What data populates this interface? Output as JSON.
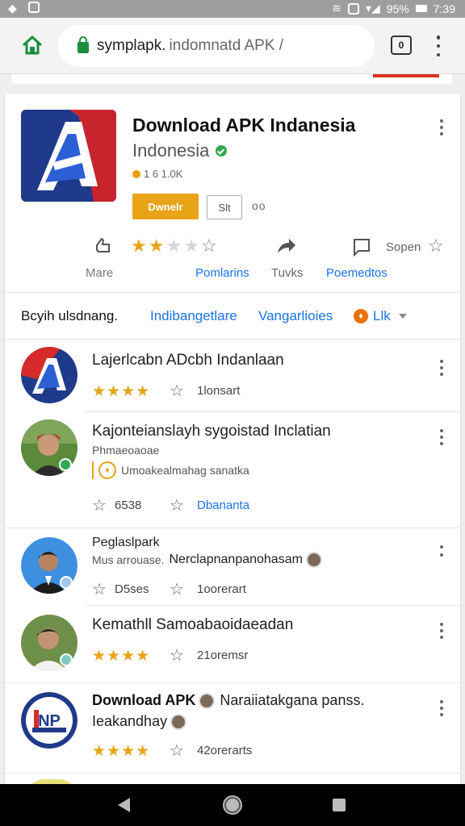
{
  "status_bar": {
    "battery": "95%",
    "time": "7:39"
  },
  "browser": {
    "url_host": "symplapk.",
    "url_path": "indomnatd APK /",
    "tab_count": "0"
  },
  "app": {
    "title": "Download APK Indanesia",
    "developer": "Indonesia",
    "size": "1 6 1.0K",
    "download_label": "Dwnelr",
    "share_label": "Slt",
    "more_label": "oo"
  },
  "actions": {
    "more_label": "Mare",
    "rating_label": "Pomlarins",
    "share_label": "Tuvks",
    "open_label": "Sopen",
    "related_label": "Poemedtos",
    "rating": 2
  },
  "filters": {
    "title": "Bcyih ulsdnang.",
    "link1": "Indibangetlare",
    "link2": "Vangarlioies",
    "chip": "Llk"
  },
  "items": [
    {
      "title": "Lajerlcabn ADcbh Indanlaan",
      "stars": "★★★★",
      "meta": "1lonsart",
      "rating": 4
    },
    {
      "title": "Kajonteianslayh sygoistad Inclatian",
      "sub1": "Phmaeoaoae",
      "sub2": "Umoakealmahag sanatka",
      "meta1": "6538",
      "meta2": "Dbananta"
    },
    {
      "title": "Peglaslpark",
      "sub1": "Mus arrouase.",
      "sub1b": "Nerclapnanpanohasam",
      "meta1": "D5ses",
      "meta2": "1oorerart"
    },
    {
      "title": "Kemathll Samoabaoidaeadan",
      "stars": "★★★★",
      "meta": "21oremsr",
      "rating": 4
    },
    {
      "title": "Download APK",
      "title2": "Naraiiatakgana panss.",
      "title3": "Ieakandhay",
      "stars": "★★★★",
      "meta": "42orerarts",
      "rating": 4
    }
  ],
  "colors": {
    "accent": "#1a73e8",
    "star": "#e8a317",
    "download": "#e8a317",
    "verified": "#34a853"
  }
}
